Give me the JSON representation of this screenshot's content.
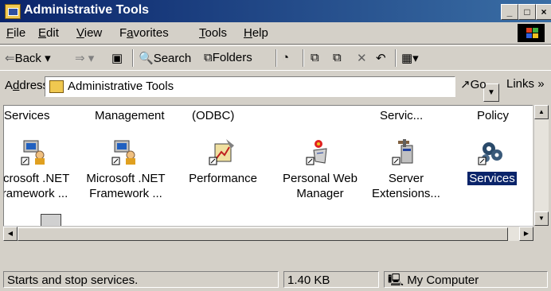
{
  "window": {
    "title": "Administrative Tools",
    "controls": {
      "minimize": "_",
      "maximize": "□",
      "close": "×"
    }
  },
  "menu": {
    "items": [
      {
        "label": "File",
        "accel": "F",
        "rest": "ile"
      },
      {
        "label": "Edit",
        "accel": "E",
        "rest": "dit"
      },
      {
        "label": "View",
        "accel": "V",
        "rest": "iew"
      },
      {
        "label": "Favorites",
        "pre": "F",
        "accel": "a",
        "rest": "vorites"
      },
      {
        "label": "Tools",
        "accel": "T",
        "rest": "ools"
      },
      {
        "label": "Help",
        "accel": "H",
        "rest": "elp"
      }
    ]
  },
  "toolbar": {
    "back": "Back",
    "search": "Search",
    "folders": "Folders",
    "icons": [
      "back-arrow-icon",
      "forward-arrow-icon",
      "up-folder-icon",
      "search-icon",
      "folders-icon",
      "history-icon",
      "move-to-icon",
      "copy-to-icon",
      "delete-icon",
      "undo-icon",
      "views-icon"
    ]
  },
  "address": {
    "label_pre": "A",
    "label_accel": "d",
    "label_rest": "dress",
    "value": "Administrative Tools",
    "go": "Go",
    "links": "Links"
  },
  "content": {
    "top_row_labels": [
      "Services",
      "Management",
      "(ODBC)",
      "Servic...",
      "Policy"
    ],
    "items": [
      {
        "name": "microsoft-net-framework-1",
        "label": "icrosoft .NET\nramework ...",
        "icon": "users-computer-icon"
      },
      {
        "name": "microsoft-net-framework-2",
        "label": "Microsoft .NET\nFramework ...",
        "icon": "users-computer-icon"
      },
      {
        "name": "performance",
        "label": "Performance",
        "icon": "performance-icon"
      },
      {
        "name": "personal-web-manager",
        "label": "Personal Web\nManager",
        "icon": "web-manager-icon"
      },
      {
        "name": "server-extensions",
        "label": "Server\nExtensions...",
        "icon": "server-extensions-icon"
      },
      {
        "name": "services",
        "label": "Services",
        "icon": "services-gears-icon",
        "selected": true
      }
    ]
  },
  "status": {
    "message": "Starts and stop services.",
    "size": "1.40 KB",
    "zone": "My Computer"
  },
  "colors": {
    "titlebar": "#0a246a",
    "face": "#d4d0c8",
    "selection": "#0a246a"
  }
}
